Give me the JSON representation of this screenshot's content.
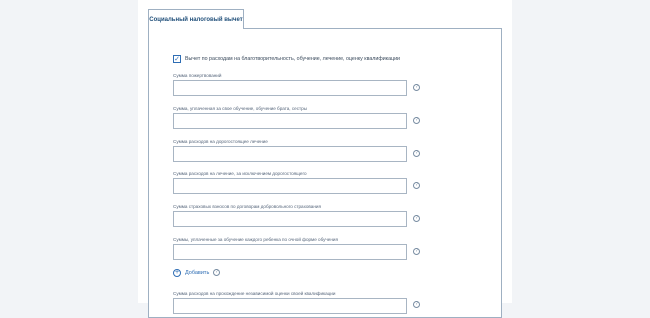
{
  "tab": {
    "label": "Социальный налоговый вычет"
  },
  "checkbox": {
    "label": "Вычет по расходам на благотворительность, обучение, лечение, оценку квалификации",
    "checked": true
  },
  "fields": [
    {
      "label": "Сумма пожертвований",
      "value": ""
    },
    {
      "label": "Сумма, уплаченная за свое обучение, обучение брата, сестры",
      "value": ""
    },
    {
      "label": "Сумма расходов на дорогостоящее лечение",
      "value": ""
    },
    {
      "label": "Сумма расходов на лечение, за исключением дорогостоящего",
      "value": ""
    },
    {
      "label": "Сумма страховых взносов по договорам добровольного страхования",
      "value": ""
    },
    {
      "label": "Суммы, уплаченные за обучение каждого ребенка по очной форме обучения",
      "value": ""
    }
  ],
  "add_button": {
    "label": "Добавить"
  },
  "extra_field": {
    "label": "Сумма расходов на прохождение независимой оценки своей квалификации"
  },
  "icons": {
    "help": "question-circle-icon",
    "add": "plus-circle-icon",
    "check": "checkmark-icon"
  },
  "colors": {
    "accent": "#2e6db4",
    "tab_text": "#1f4e79",
    "border": "#9fb0c2"
  }
}
